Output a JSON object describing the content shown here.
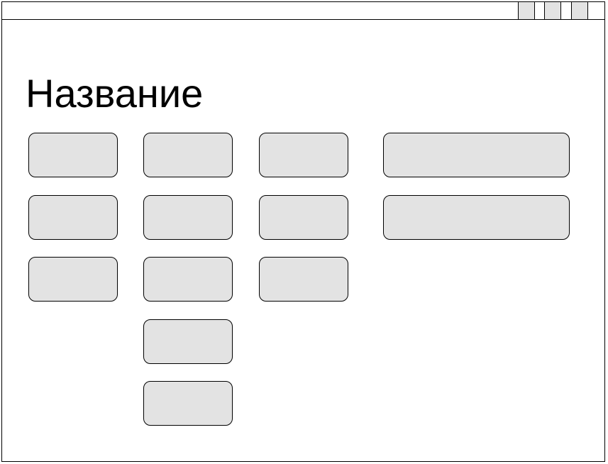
{
  "window": {
    "title": "",
    "controls": [
      "minimize-button",
      "maximize-button",
      "close-button"
    ]
  },
  "main": {
    "title": "Название"
  },
  "tiles": {
    "column_1": [
      "",
      "",
      ""
    ],
    "column_2": [
      "",
      "",
      "",
      "",
      ""
    ],
    "column_3": [
      "",
      "",
      ""
    ],
    "wide_column": [
      "",
      ""
    ]
  },
  "colors": {
    "tile_fill": "#e3e3e3",
    "border": "#000000",
    "background": "#ffffff"
  }
}
